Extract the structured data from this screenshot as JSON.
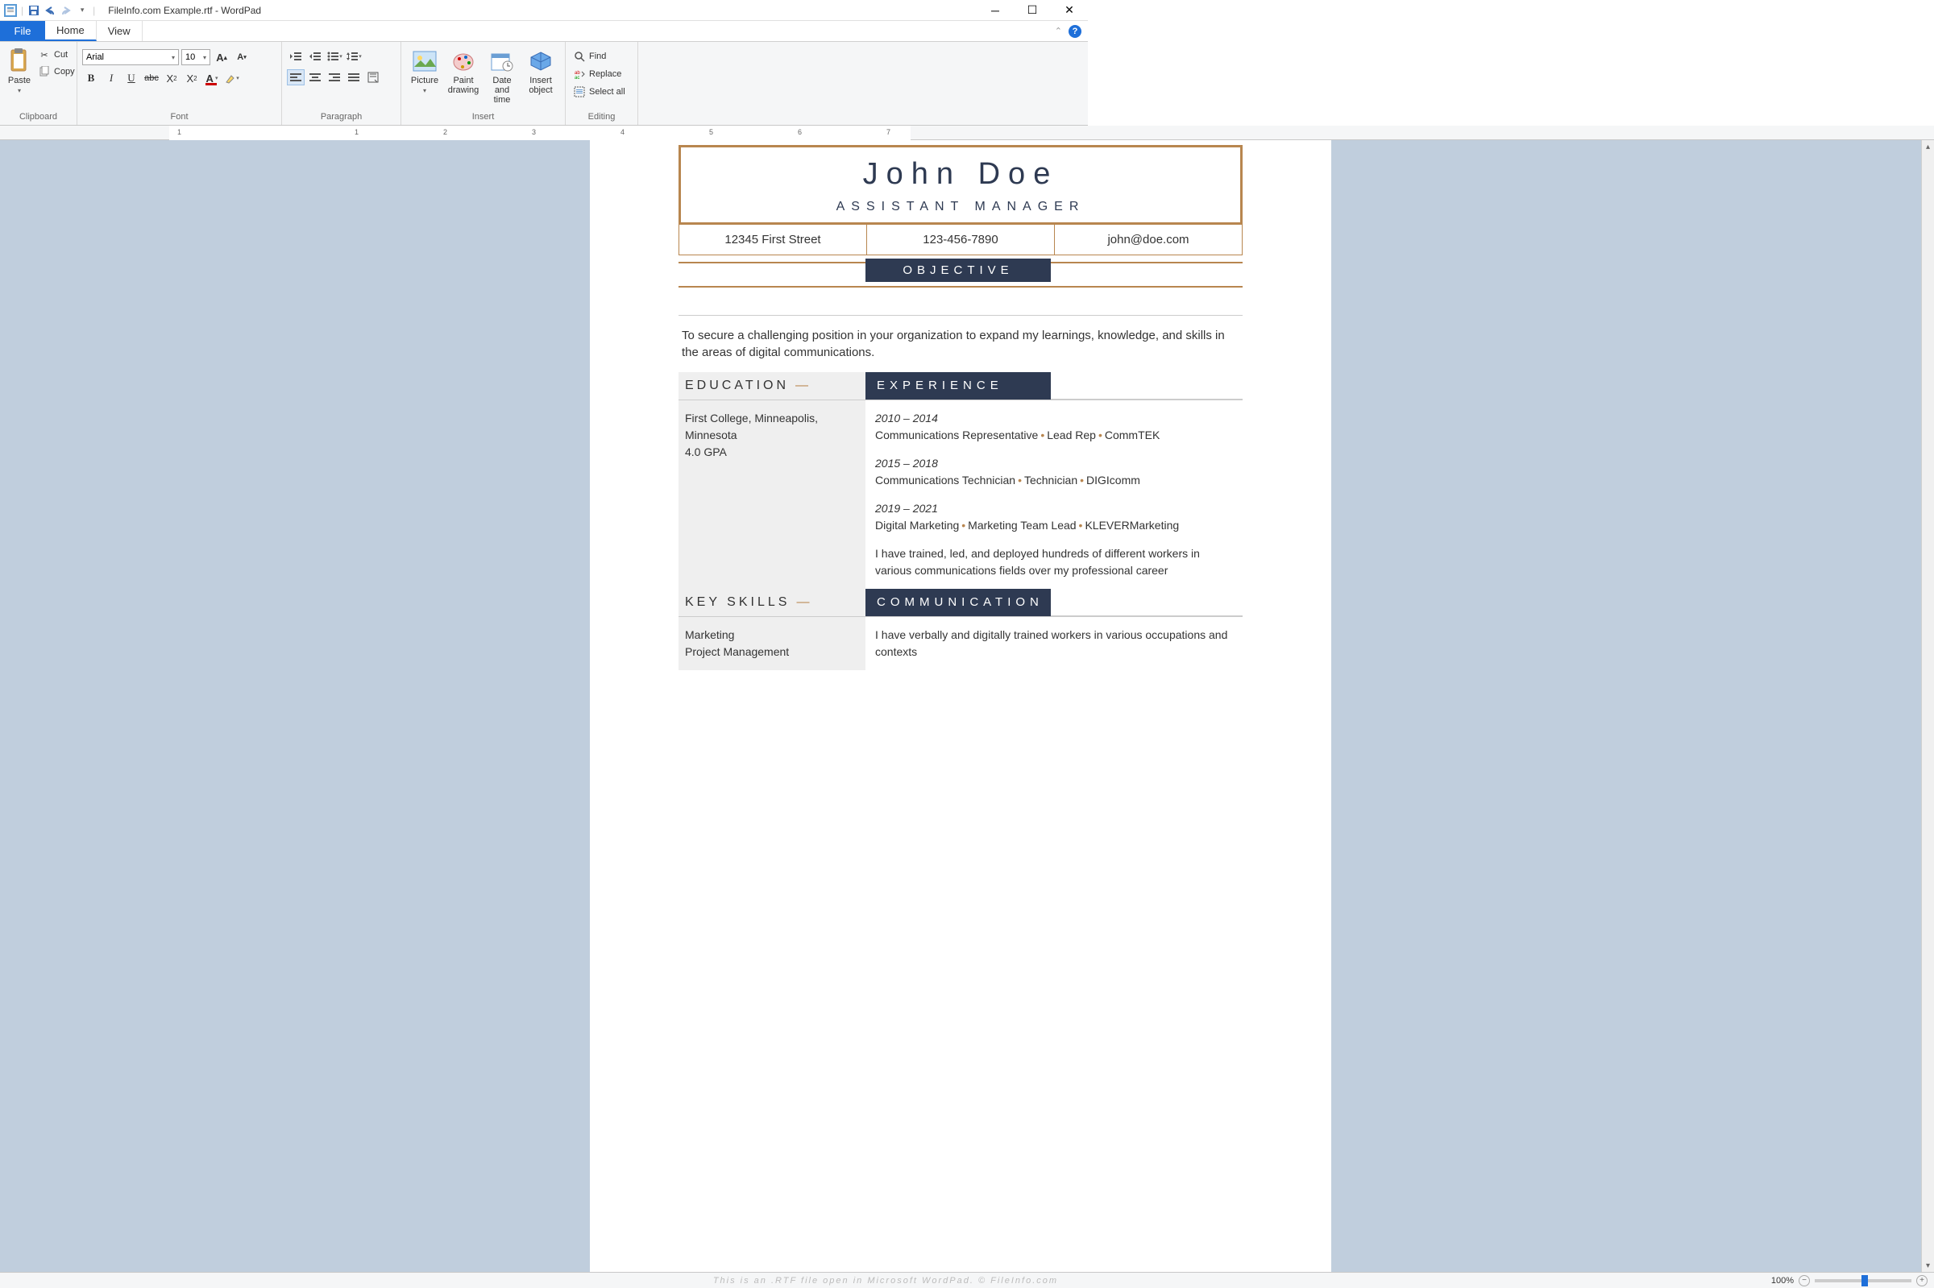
{
  "titlebar": {
    "title": "FileInfo.com Example.rtf - WordPad"
  },
  "menubar": {
    "file": "File",
    "tabs": [
      "Home",
      "View"
    ]
  },
  "ribbon": {
    "clipboard": {
      "label": "Clipboard",
      "paste": "Paste",
      "cut": "Cut",
      "copy": "Copy"
    },
    "font": {
      "label": "Font",
      "family": "Arial",
      "size": "10"
    },
    "paragraph": {
      "label": "Paragraph"
    },
    "insert": {
      "label": "Insert",
      "picture": "Picture",
      "paint": "Paint drawing",
      "date": "Date and time",
      "object": "Insert object"
    },
    "editing": {
      "label": "Editing",
      "find": "Find",
      "replace": "Replace",
      "selectall": "Select all"
    }
  },
  "ruler": {
    "ticks": [
      "1",
      "1",
      "2",
      "3",
      "4",
      "5",
      "6",
      "7"
    ]
  },
  "document": {
    "name": "John Doe",
    "subtitle": "ASSISTANT MANAGER",
    "contact": {
      "address": "12345 First Street",
      "phone": "123-456-7890",
      "email": "john@doe.com"
    },
    "objective_label": "OBJECTIVE",
    "objective_text": "To secure a challenging position in your organization to expand my learnings, knowledge, and skills in the areas of digital communications.",
    "education_label": "EDUCATION",
    "experience_label": "EXPERIENCE",
    "education": {
      "school": "First College, Minneapolis, Minnesota",
      "gpa": "4.0 GPA"
    },
    "experience": [
      {
        "years": "2010 – 2014",
        "title": "Communications Representative",
        "role": "Lead Rep",
        "company": "CommTEK"
      },
      {
        "years": "2015 – 2018",
        "title": "Communications Technician",
        "role": "Technician",
        "company": "DIGIcomm"
      },
      {
        "years": "2019 – 2021",
        "title": "Digital Marketing",
        "role": "Marketing Team Lead",
        "company": "KLEVERMarketing"
      }
    ],
    "experience_summary": "I have trained, led, and deployed hundreds of different workers in various communications fields over my professional career",
    "keyskills_label": "KEY SKILLS",
    "communication_label": "COMMUNICATION",
    "skills": [
      "Marketing",
      "Project Management"
    ],
    "communication_text": "I have verbally and digitally trained workers in various occupations and contexts"
  },
  "statusbar": {
    "caption": "This is an .RTF file open in Microsoft WordPad. © FileInfo.com",
    "zoom": "100%"
  }
}
